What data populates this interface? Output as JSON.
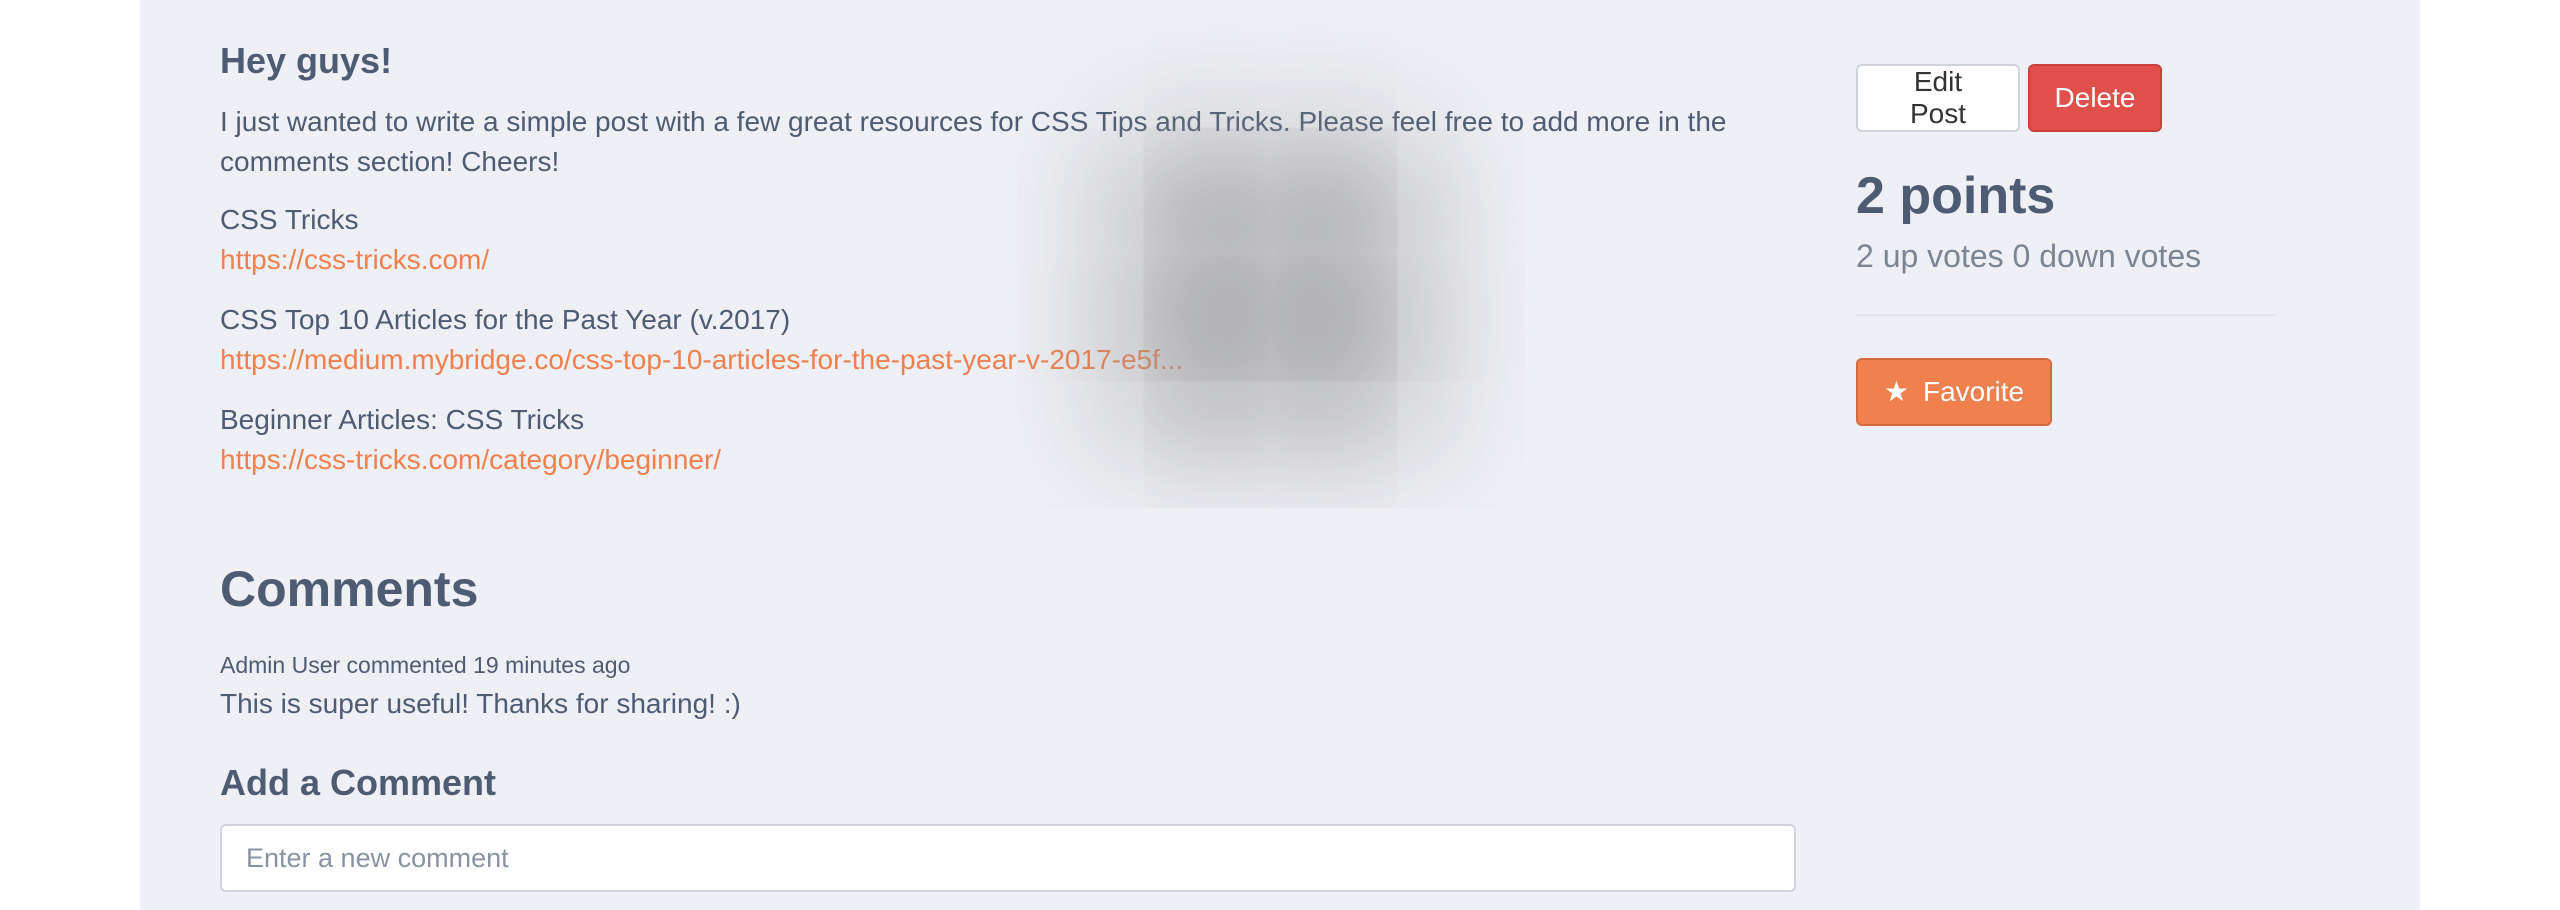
{
  "post": {
    "title": "Hey guys!",
    "body": "I just wanted to write a simple post with a few great resources for CSS Tips and Tricks. Please feel free to add more in the comments section! Cheers!",
    "resources": [
      {
        "name": "CSS Tricks",
        "url": "https://css-tricks.com/"
      },
      {
        "name": "CSS Top 10 Articles for the Past Year (v.2017)",
        "url": "https://medium.mybridge.co/css-top-10-articles-for-the-past-year-v-2017-e5f..."
      },
      {
        "name": "Beginner Articles: CSS Tricks",
        "url": "https://css-tricks.com/category/beginner/"
      }
    ]
  },
  "actions": {
    "edit_label": "Edit Post",
    "delete_label": "Delete",
    "favorite_label": "Favorite",
    "favorite_icon": "star-icon"
  },
  "score": {
    "points": "2 points",
    "votes": "2 up votes 0 down votes"
  },
  "comments": {
    "heading": "Comments",
    "items": [
      {
        "meta": "Admin User commented 19 minutes ago",
        "text": "This is super useful! Thanks for sharing! :)"
      }
    ],
    "add_heading": "Add a Comment",
    "input_placeholder": "Enter a new comment",
    "input_value": ""
  },
  "colors": {
    "accent": "#f0804e",
    "danger": "#e14f4b",
    "text": "#4d5b73",
    "panel_bg": "#eff0f5"
  }
}
